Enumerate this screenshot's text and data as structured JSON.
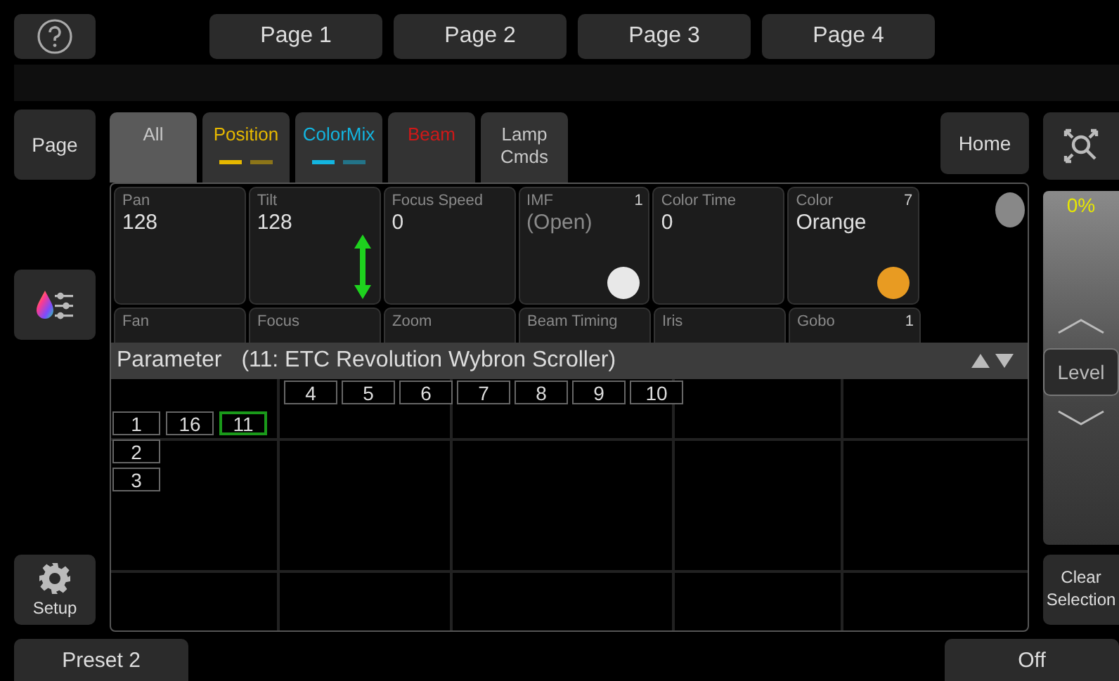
{
  "top_bar": {
    "pages": [
      {
        "label": "Page 1"
      },
      {
        "label": "Page 2"
      },
      {
        "label": "Page 3"
      },
      {
        "label": "Page 4"
      }
    ]
  },
  "left_column": {
    "page_button": "Page",
    "setup_button": "Setup"
  },
  "tabs": [
    {
      "label": "All",
      "selected": true,
      "color": "#c8c8c8",
      "indicator": false
    },
    {
      "label": "Position",
      "selected": false,
      "color": "#e6b800",
      "indicator": true
    },
    {
      "label": "ColorMix",
      "selected": false,
      "color": "#13b5e0",
      "indicator": true
    },
    {
      "label": "Beam",
      "selected": false,
      "color": "#d01818",
      "indicator": false
    },
    {
      "label": "Lamp Cmds",
      "selected": false,
      "color": "#c8c8c8",
      "indicator": false
    }
  ],
  "home_button": "Home",
  "encoders": [
    {
      "label": "Pan",
      "value": "128",
      "dimmed": false
    },
    {
      "label": "Tilt",
      "value": "128",
      "dimmed": false,
      "arrow": true
    },
    {
      "label": "Focus Speed",
      "value": "0",
      "dimmed": false
    },
    {
      "label": "IMF",
      "value": "(Open)",
      "count": "1",
      "dimmed": true,
      "color": "#e8e8e8"
    },
    {
      "label": "Color Time",
      "value": "0",
      "dimmed": false
    },
    {
      "label": "Color",
      "value": "Orange",
      "count": "7",
      "dimmed": false,
      "color": "#e89b22"
    }
  ],
  "encoders_row_2": [
    {
      "label": "Fan"
    },
    {
      "label": "Focus"
    },
    {
      "label": "Zoom"
    },
    {
      "label": "Beam Timing"
    },
    {
      "label": "Iris"
    },
    {
      "label": "Gobo",
      "count": "1"
    }
  ],
  "parameter_bar": {
    "label": "Parameter",
    "target": "(11: ETC Revolution Wybron Scroller)"
  },
  "grid": {
    "column_headers": [
      "4",
      "5",
      "6",
      "7",
      "8",
      "9",
      "10"
    ],
    "rows": [
      {
        "cells": [
          {
            "label": "1",
            "selected": false
          },
          {
            "label": "16",
            "selected": false
          },
          {
            "label": "11",
            "selected": true
          }
        ]
      },
      {
        "cells": [
          {
            "label": "2",
            "selected": false
          }
        ]
      },
      {
        "cells": [
          {
            "label": "3",
            "selected": false
          }
        ]
      }
    ]
  },
  "fader": {
    "reading": "0%",
    "label": "Level",
    "level": 0
  },
  "clear_button": "Clear Selection",
  "bottom_bar": {
    "preset_button": "Preset 2",
    "off_button": "Off"
  }
}
